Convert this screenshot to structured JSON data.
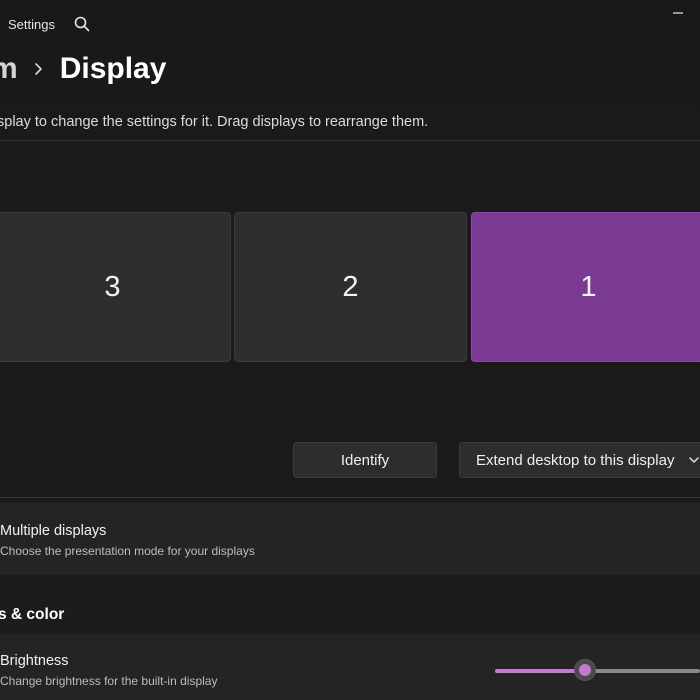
{
  "window": {
    "app_title": "Settings",
    "search_icon": "search-icon",
    "minimize_icon": "minimize-icon"
  },
  "breadcrumb": {
    "parent": "m",
    "separator_icon": "chevron-right-icon",
    "current": "Display"
  },
  "instruction": "splay to change the settings for it. Drag displays to rearrange them.",
  "monitors": [
    {
      "label": "3",
      "selected": false
    },
    {
      "label": "2",
      "selected": false
    },
    {
      "label": "1",
      "selected": true
    }
  ],
  "colors": {
    "accent": "#7a3a93",
    "slider_accent": "#c17ad0",
    "background": "#1b1b1b",
    "card": "#242424"
  },
  "actions": {
    "identify_label": "Identify",
    "extend_label": "Extend desktop to this display",
    "extend_chevron_icon": "chevron-down-icon"
  },
  "multiple_displays": {
    "title": "Multiple displays",
    "description": "Choose the presentation mode for your displays"
  },
  "brightness_section": {
    "heading": "s & color"
  },
  "brightness": {
    "title": "Brightness",
    "description": "Change brightness for the built-in display",
    "slider_fraction": 0.44
  }
}
